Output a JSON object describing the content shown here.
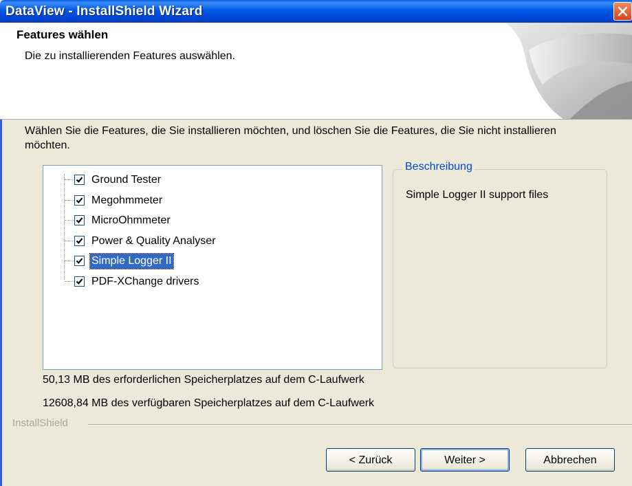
{
  "window": {
    "title": "DataView - InstallShield Wizard"
  },
  "header": {
    "title": "Features wählen",
    "subtitle": "Die zu installierenden Features auswählen."
  },
  "instructions": "Wählen Sie die Features, die Sie installieren möchten, und löschen Sie die Features, die Sie nicht installieren möchten.",
  "features": [
    {
      "label": "Ground Tester",
      "checked": true
    },
    {
      "label": "Megohmmeter",
      "checked": true
    },
    {
      "label": "MicroOhmmeter",
      "checked": true
    },
    {
      "label": "Power & Quality Analyser",
      "checked": true
    },
    {
      "label": "Simple Logger II",
      "checked": true,
      "selected": true
    },
    {
      "label": "PDF-XChange drivers",
      "checked": true
    }
  ],
  "description": {
    "legend": "Beschreibung",
    "text": "Simple Logger II support files"
  },
  "disk": {
    "required": "50,13 MB des erforderlichen Speicherplatzes auf dem C-Laufwerk",
    "available": "12608,84 MB des verfügbaren Speicherplatzes auf dem C-Laufwerk"
  },
  "brand": "InstallShield",
  "buttons": {
    "back": "< Zurück",
    "next": "Weiter >",
    "cancel": "Abbrechen"
  },
  "colors": {
    "titlebar": "#0058e6",
    "selection": "#316ac5",
    "legend": "#0046d5"
  },
  "icons": {
    "close": "close-icon",
    "checkbox": "checkmark-icon"
  }
}
